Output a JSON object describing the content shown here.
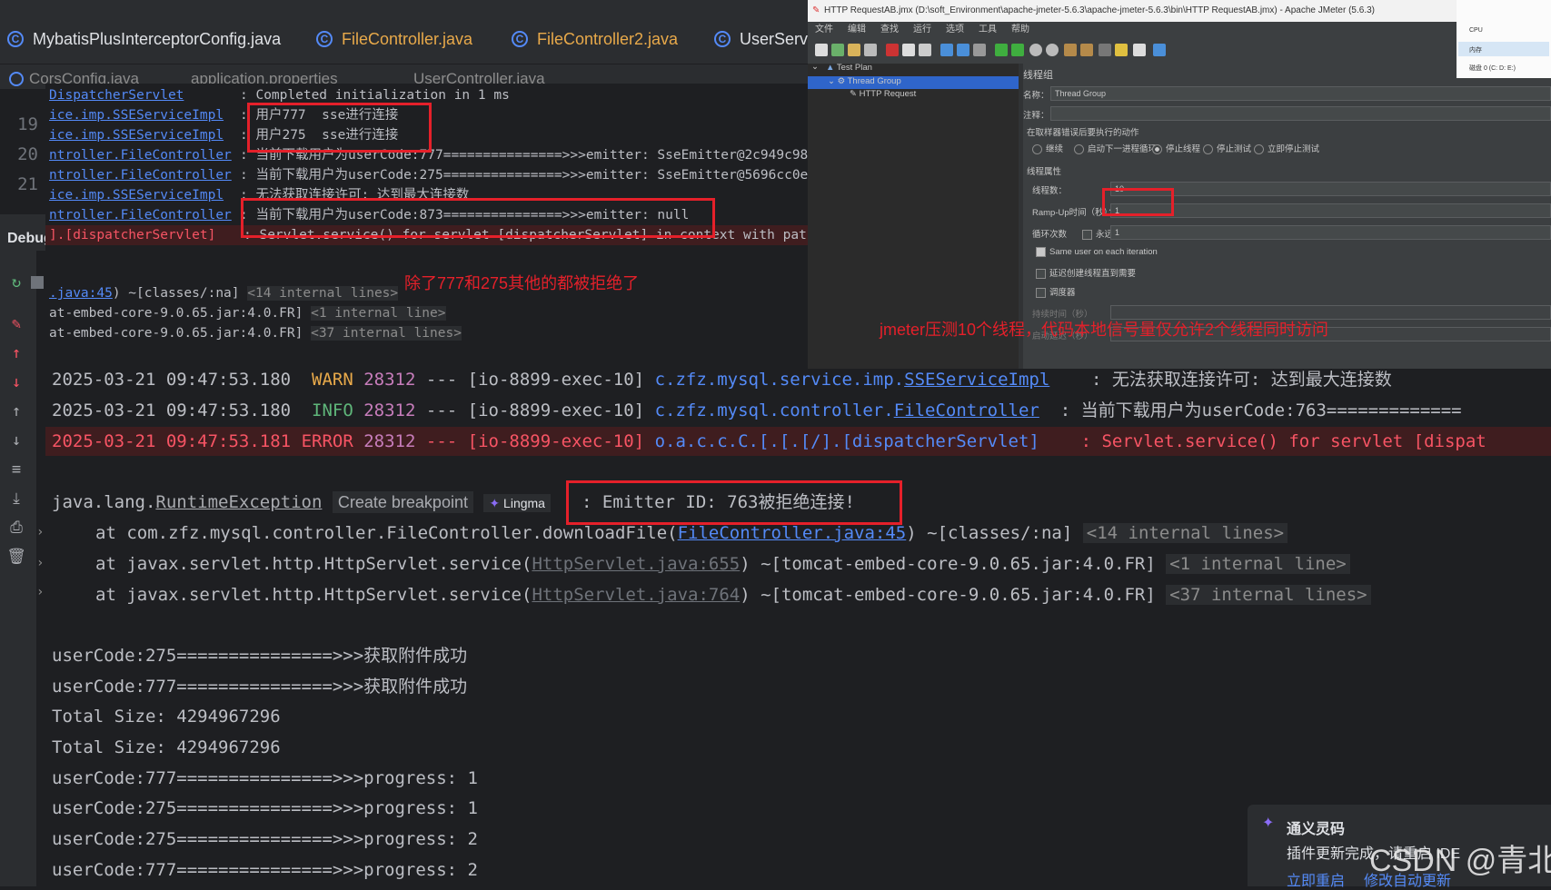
{
  "tabs": [
    {
      "label": "MybatisPlusInterceptorConfig.java",
      "icon": "class-icon"
    },
    {
      "label": "FileController.java",
      "icon": "class-icon"
    },
    {
      "label": "FileController2.java",
      "icon": "class-icon"
    },
    {
      "label": "UserServic",
      "icon": "class-icon"
    }
  ],
  "tabs_row2": [
    "CorsConfig.java",
    "application.properties",
    "UserController.java"
  ],
  "gutter_lines": [
    "19",
    "20",
    "21"
  ],
  "debug_label": "Debug",
  "overlay_log": [
    {
      "cls": "DispatcherServlet",
      "msg": ": Completed initialization in 1 ms"
    },
    {
      "cls": "ice.imp.SSEServiceImpl",
      "msg": ": 用户777  sse进行连接"
    },
    {
      "cls": "ice.imp.SSEServiceImpl",
      "msg": ": 用户275  sse进行连接"
    },
    {
      "cls": "ntroller.FileController",
      "msg": ": 当前下载用户为userCode:777===============>>>emitter: SseEmitter@2c949c98"
    },
    {
      "cls": "ntroller.FileController",
      "msg": ": 当前下载用户为userCode:275===============>>>emitter: SseEmitter@5696cc0e"
    },
    {
      "cls": "ice.imp.SSEServiceImpl",
      "msg": ": 无法获取连接许可: 达到最大连接数"
    },
    {
      "cls": "ntroller.FileController",
      "msg": ": 当前下载用户为userCode:873===============>>>emitter: null"
    },
    {
      "cls": "].[dispatcherServlet]",
      "msg": ": Servlet.service() for servlet [dispatcherServlet] in context with path ["
    }
  ],
  "overlay_trace": [
    {
      "link": ".java:45",
      "rest": ") ~[classes/:na]",
      "internal": "<14 internal lines>"
    },
    {
      "link": "",
      "rest": "at-embed-core-9.0.65.jar:4.0.FR]",
      "internal": "<1 internal line>"
    },
    {
      "link": "",
      "rest": "at-embed-core-9.0.65.jar:4.0.FR]",
      "internal": "<37 internal lines>"
    }
  ],
  "annotation_left": "除了777和275其他的都被拒绝了",
  "annotation_right": "jmeter压测10个线程，代码本地信号量仅允许2个线程同时访问",
  "jmeter": {
    "title": "HTTP RequestAB.jmx (D:\\soft_Environment\\apache-jmeter-5.6.3\\apache-jmeter-5.6.3\\bin\\HTTP RequestAB.jmx) - Apache JMeter (5.6.3)",
    "menu": [
      "文件",
      "编辑",
      "查找",
      "运行",
      "选项",
      "工具",
      "帮助"
    ],
    "tree": [
      "Test Plan",
      "Thread Group",
      "HTTP Request"
    ],
    "panel_title": "线程组",
    "name_label": "名称：",
    "name_value": "Thread Group",
    "comment_label": "注释：",
    "error_action_label": "在取样器错误后要执行的动作",
    "error_actions": [
      "继续",
      "启动下一进程循环",
      "停止线程",
      "停止测试",
      "立即停止测试"
    ],
    "selected_action": "停止线程",
    "thread_props_label": "线程属性",
    "threads_label": "线程数：",
    "threads_value": "10",
    "rampup_label": "Ramp-Up时间（秒）：",
    "rampup_value": "1",
    "loop_label": "循环次数",
    "forever_label": "永远",
    "loop_value": "1",
    "same_user": "Same user on each iteration",
    "delay_create": "延迟创建线程直到需要",
    "scheduler": "调度器",
    "duration": "持续时间（秒）",
    "startup_delay": "启动延迟（秒）"
  },
  "sysmon": {
    "cpu": "CPU",
    "mem": "内存",
    "disk": "磁盘 0 (C: D: E:)"
  },
  "console": [
    {
      "ts": "2025-03-21 09:47:53.180",
      "level": "WARN",
      "pid": "28312",
      "sep": "---",
      "thread": "[io-8899-exec-10]",
      "logger_pre": "c.zfz.mysql.service.imp.",
      "logger_u": "SSEServiceImpl",
      "msg": ": 无法获取连接许可: 达到最大连接数"
    },
    {
      "ts": "2025-03-21 09:47:53.180",
      "level": "INFO",
      "pid": "28312",
      "sep": "---",
      "thread": "[io-8899-exec-10]",
      "logger_pre": "c.zfz.mysql.controller.",
      "logger_u": "FileController",
      "msg": ": 当前下载用户为userCode:763============="
    },
    {
      "ts": "2025-03-21 09:47:53.181",
      "level": "ERROR",
      "pid": "28312",
      "sep": "---",
      "thread": "[io-8899-exec-10]",
      "logger_pre": "o.a.c.c.C.[.[.[/].[dispatcherServlet]",
      "logger_u": "",
      "msg": ": Servlet.service() for servlet [dispat"
    }
  ],
  "exception": {
    "prefix": "java.lang.",
    "name": "RuntimeException",
    "breakpoint_btn": "Create breakpoint",
    "lingma": "Lingma",
    "message": ": Emitter ID: 763被拒绝连接!"
  },
  "stack": [
    {
      "pre": "at com.zfz.mysql.controller.FileController.downloadFile(",
      "link": "FileController.java:45",
      "post": ") ~[classes/:na]",
      "internal": "<14 internal lines>"
    },
    {
      "pre": "at javax.servlet.http.HttpServlet.service(",
      "link": "HttpServlet.java:655",
      "post": ") ~[tomcat-embed-core-9.0.65.jar:4.0.FR]",
      "internal": "<1 internal line>"
    },
    {
      "pre": "at javax.servlet.http.HttpServlet.service(",
      "link": "HttpServlet.java:764",
      "post": ") ~[tomcat-embed-core-9.0.65.jar:4.0.FR]",
      "internal": "<37 internal lines>"
    }
  ],
  "output_lines": [
    "userCode:275===============>>>获取附件成功",
    "userCode:777===============>>>获取附件成功",
    "Total Size: 4294967296",
    "Total Size: 4294967296",
    "userCode:777===============>>>progress: 1",
    "userCode:275===============>>>progress: 1",
    "userCode:275===============>>>progress: 2",
    "userCode:777===============>>>progress: 2"
  ],
  "notification": {
    "title": "通义灵码",
    "body": "插件更新完成，请重启 IDE",
    "action1": "立即重启",
    "action2": "修改自动更新"
  },
  "watermark": "CSDN @青北念"
}
